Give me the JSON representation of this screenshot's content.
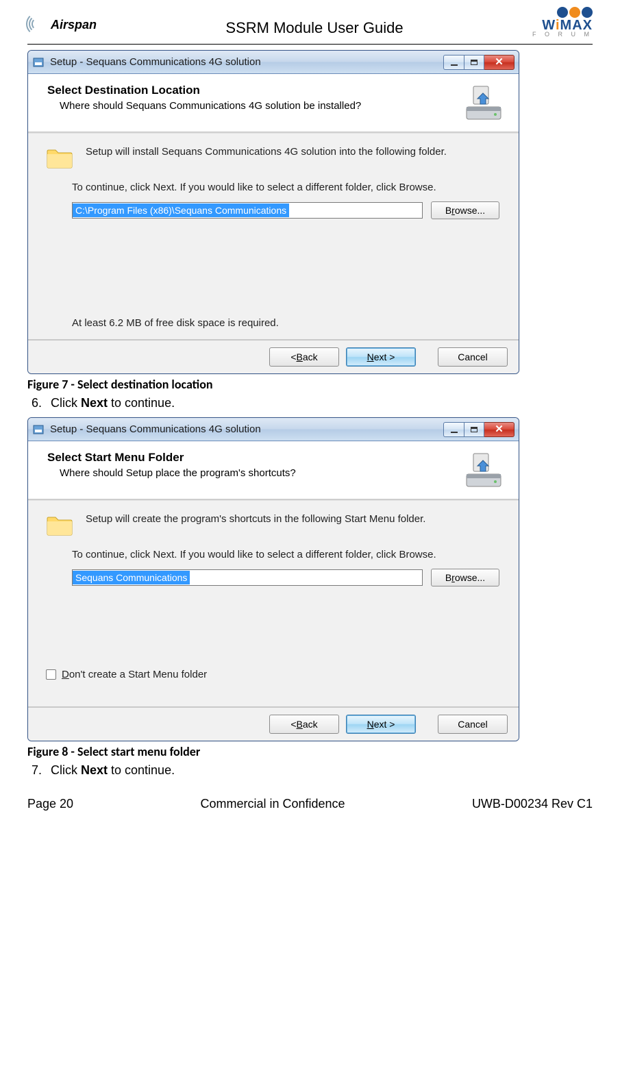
{
  "header": {
    "airspan_label": "Airspan",
    "doc_title": "SSRM Module User Guide",
    "wimax_w": "W",
    "wimax_i": "i",
    "wimax_max": "MAX",
    "wimax_forum": "F O R U M"
  },
  "win1": {
    "title": "Setup - Sequans Communications 4G solution",
    "header_h1": "Select Destination Location",
    "header_h2": "Where should Sequans Communications 4G solution be installed?",
    "install_line": "Setup will install Sequans Communications 4G solution into the following folder.",
    "continue_line": "To continue, click Next. If you would like to select a different folder, click Browse.",
    "path_value": "C:\\Program Files (x86)\\Sequans Communications",
    "browse_pre": "B",
    "browse_u": "r",
    "browse_post": "owse...",
    "disk_space": "At least 6.2 MB of free disk space is required.",
    "btn_back_pre": "< ",
    "btn_back_u": "B",
    "btn_back_post": "ack",
    "btn_next_u": "N",
    "btn_next_post": "ext >",
    "btn_cancel": "Cancel"
  },
  "caption1": "Figure 7 - Select destination location",
  "step1_num": "6.",
  "step1_pre": "Click ",
  "step1_bold": "Next",
  "step1_post": " to continue.",
  "win2": {
    "title": "Setup - Sequans Communications 4G solution",
    "header_h1": "Select Start Menu Folder",
    "header_h2": "Where should Setup place the program's shortcuts?",
    "install_line": "Setup will create the program's shortcuts in the following Start Menu folder.",
    "continue_line": "To continue, click Next. If you would like to select a different folder, click Browse.",
    "path_value": "Sequans Communications",
    "browse_pre": "B",
    "browse_u": "r",
    "browse_post": "owse...",
    "dont_create_u": "D",
    "dont_create_post": "on't create a Start Menu folder",
    "btn_back_pre": "< ",
    "btn_back_u": "B",
    "btn_back_post": "ack",
    "btn_next_u": "N",
    "btn_next_post": "ext >",
    "btn_cancel": "Cancel"
  },
  "caption2": "Figure 8 - Select start menu folder",
  "step2_num": "7.",
  "step2_pre": "Click ",
  "step2_bold": "Next",
  "step2_post": " to continue.",
  "footer": {
    "page": "Page 20",
    "conf": "Commercial in Confidence",
    "rev": "UWB-D00234 Rev C1"
  }
}
